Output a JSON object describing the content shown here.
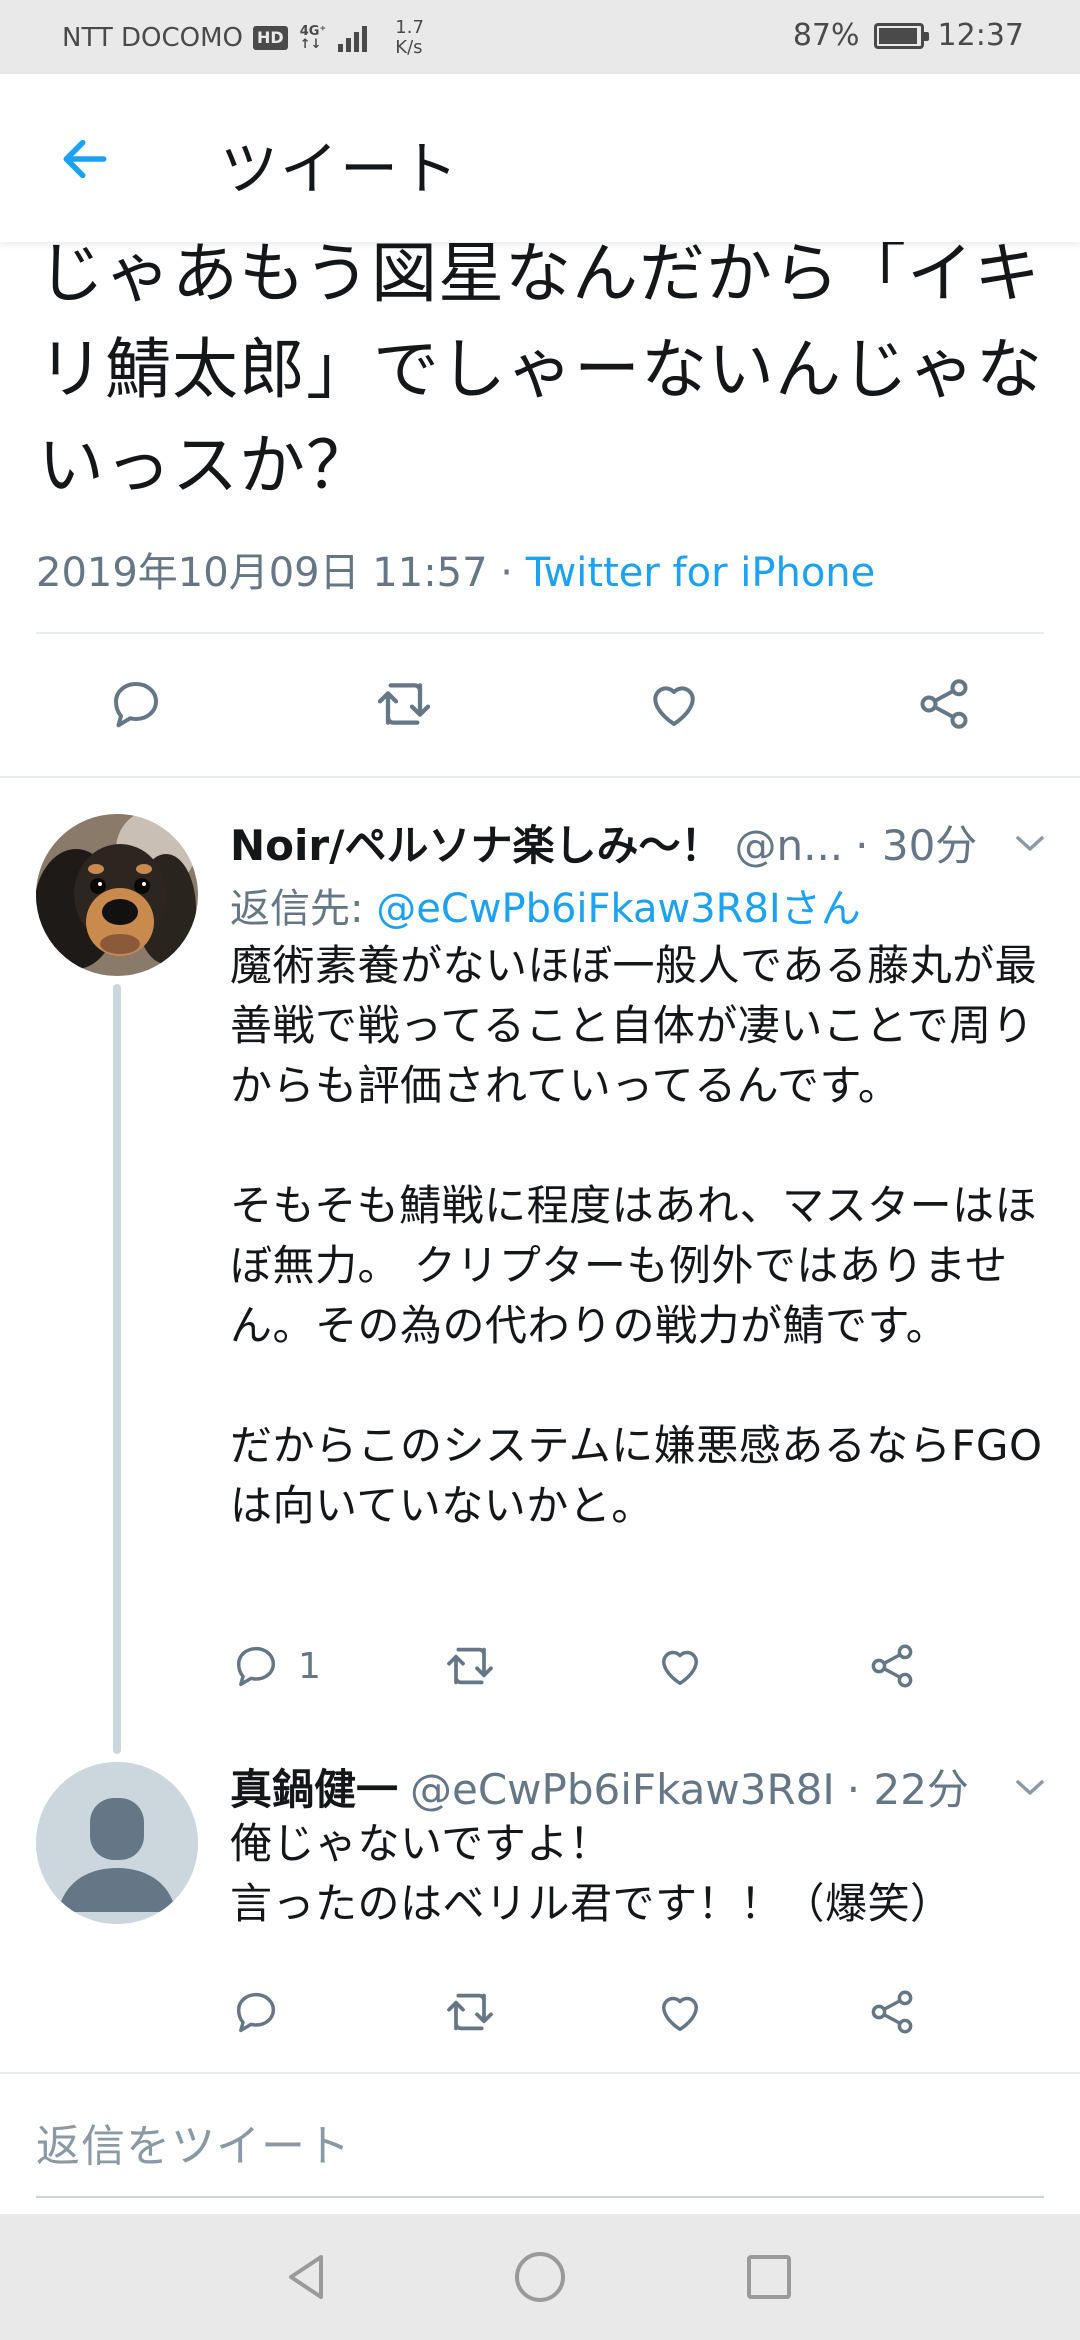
{
  "status_bar": {
    "carrier": "NTT DOCOMO",
    "hd": "HD",
    "network_top": "4G⁺",
    "network_bottom": "↑↓",
    "speed_value": "1.7",
    "speed_unit": "K/s",
    "battery": "87%",
    "time": "12:37"
  },
  "header": {
    "title": "ツイート"
  },
  "main_tweet": {
    "text": "じゃあもう図星なんだから「イキリ鯖太郎」でしゃーないんじゃないっスか？",
    "date": "2019年10月09日 11:57",
    "separator": " · ",
    "source": "Twitter for iPhone"
  },
  "replies": [
    {
      "name": "Noir/ペルソナ楽しみ〜！",
      "handle": "@n...",
      "time": "· 30分",
      "reply_to_prefix": "返信先: ",
      "reply_to_mention": "@eCwPb6iFkaw3R8Iさん",
      "text": "魔術素養がないほぼ一般人である藤丸が最善戦で戦ってること自体が凄いことで周りからも評価されていってるんです。\n\nそもそも鯖戦に程度はあれ、マスターはほぼ無力。 クリプターも例外ではありません。その為の代わりの戦力が鯖です。\n\nだからこのシステムに嫌悪感あるならFGOは向いていないかと。",
      "reply_count": "1"
    },
    {
      "name": "真鍋健一",
      "handle": "@eCwPb6iFkaw3R8I",
      "time": "· 22分",
      "text": "俺じゃないですよ！\n言ったのはベリル君です！！（爆笑）",
      "reply_count": ""
    }
  ],
  "composer": {
    "placeholder": "返信をツイート"
  },
  "colors": {
    "accent": "#1da1f2",
    "secondary_text": "#657786",
    "icon": "#657786",
    "divider": "#e6ecf0"
  },
  "icons": [
    "back-arrow-icon",
    "reply-icon",
    "retweet-icon",
    "like-icon",
    "share-icon",
    "chevron-down-icon",
    "nav-back-icon",
    "nav-home-icon",
    "nav-recents-icon"
  ]
}
